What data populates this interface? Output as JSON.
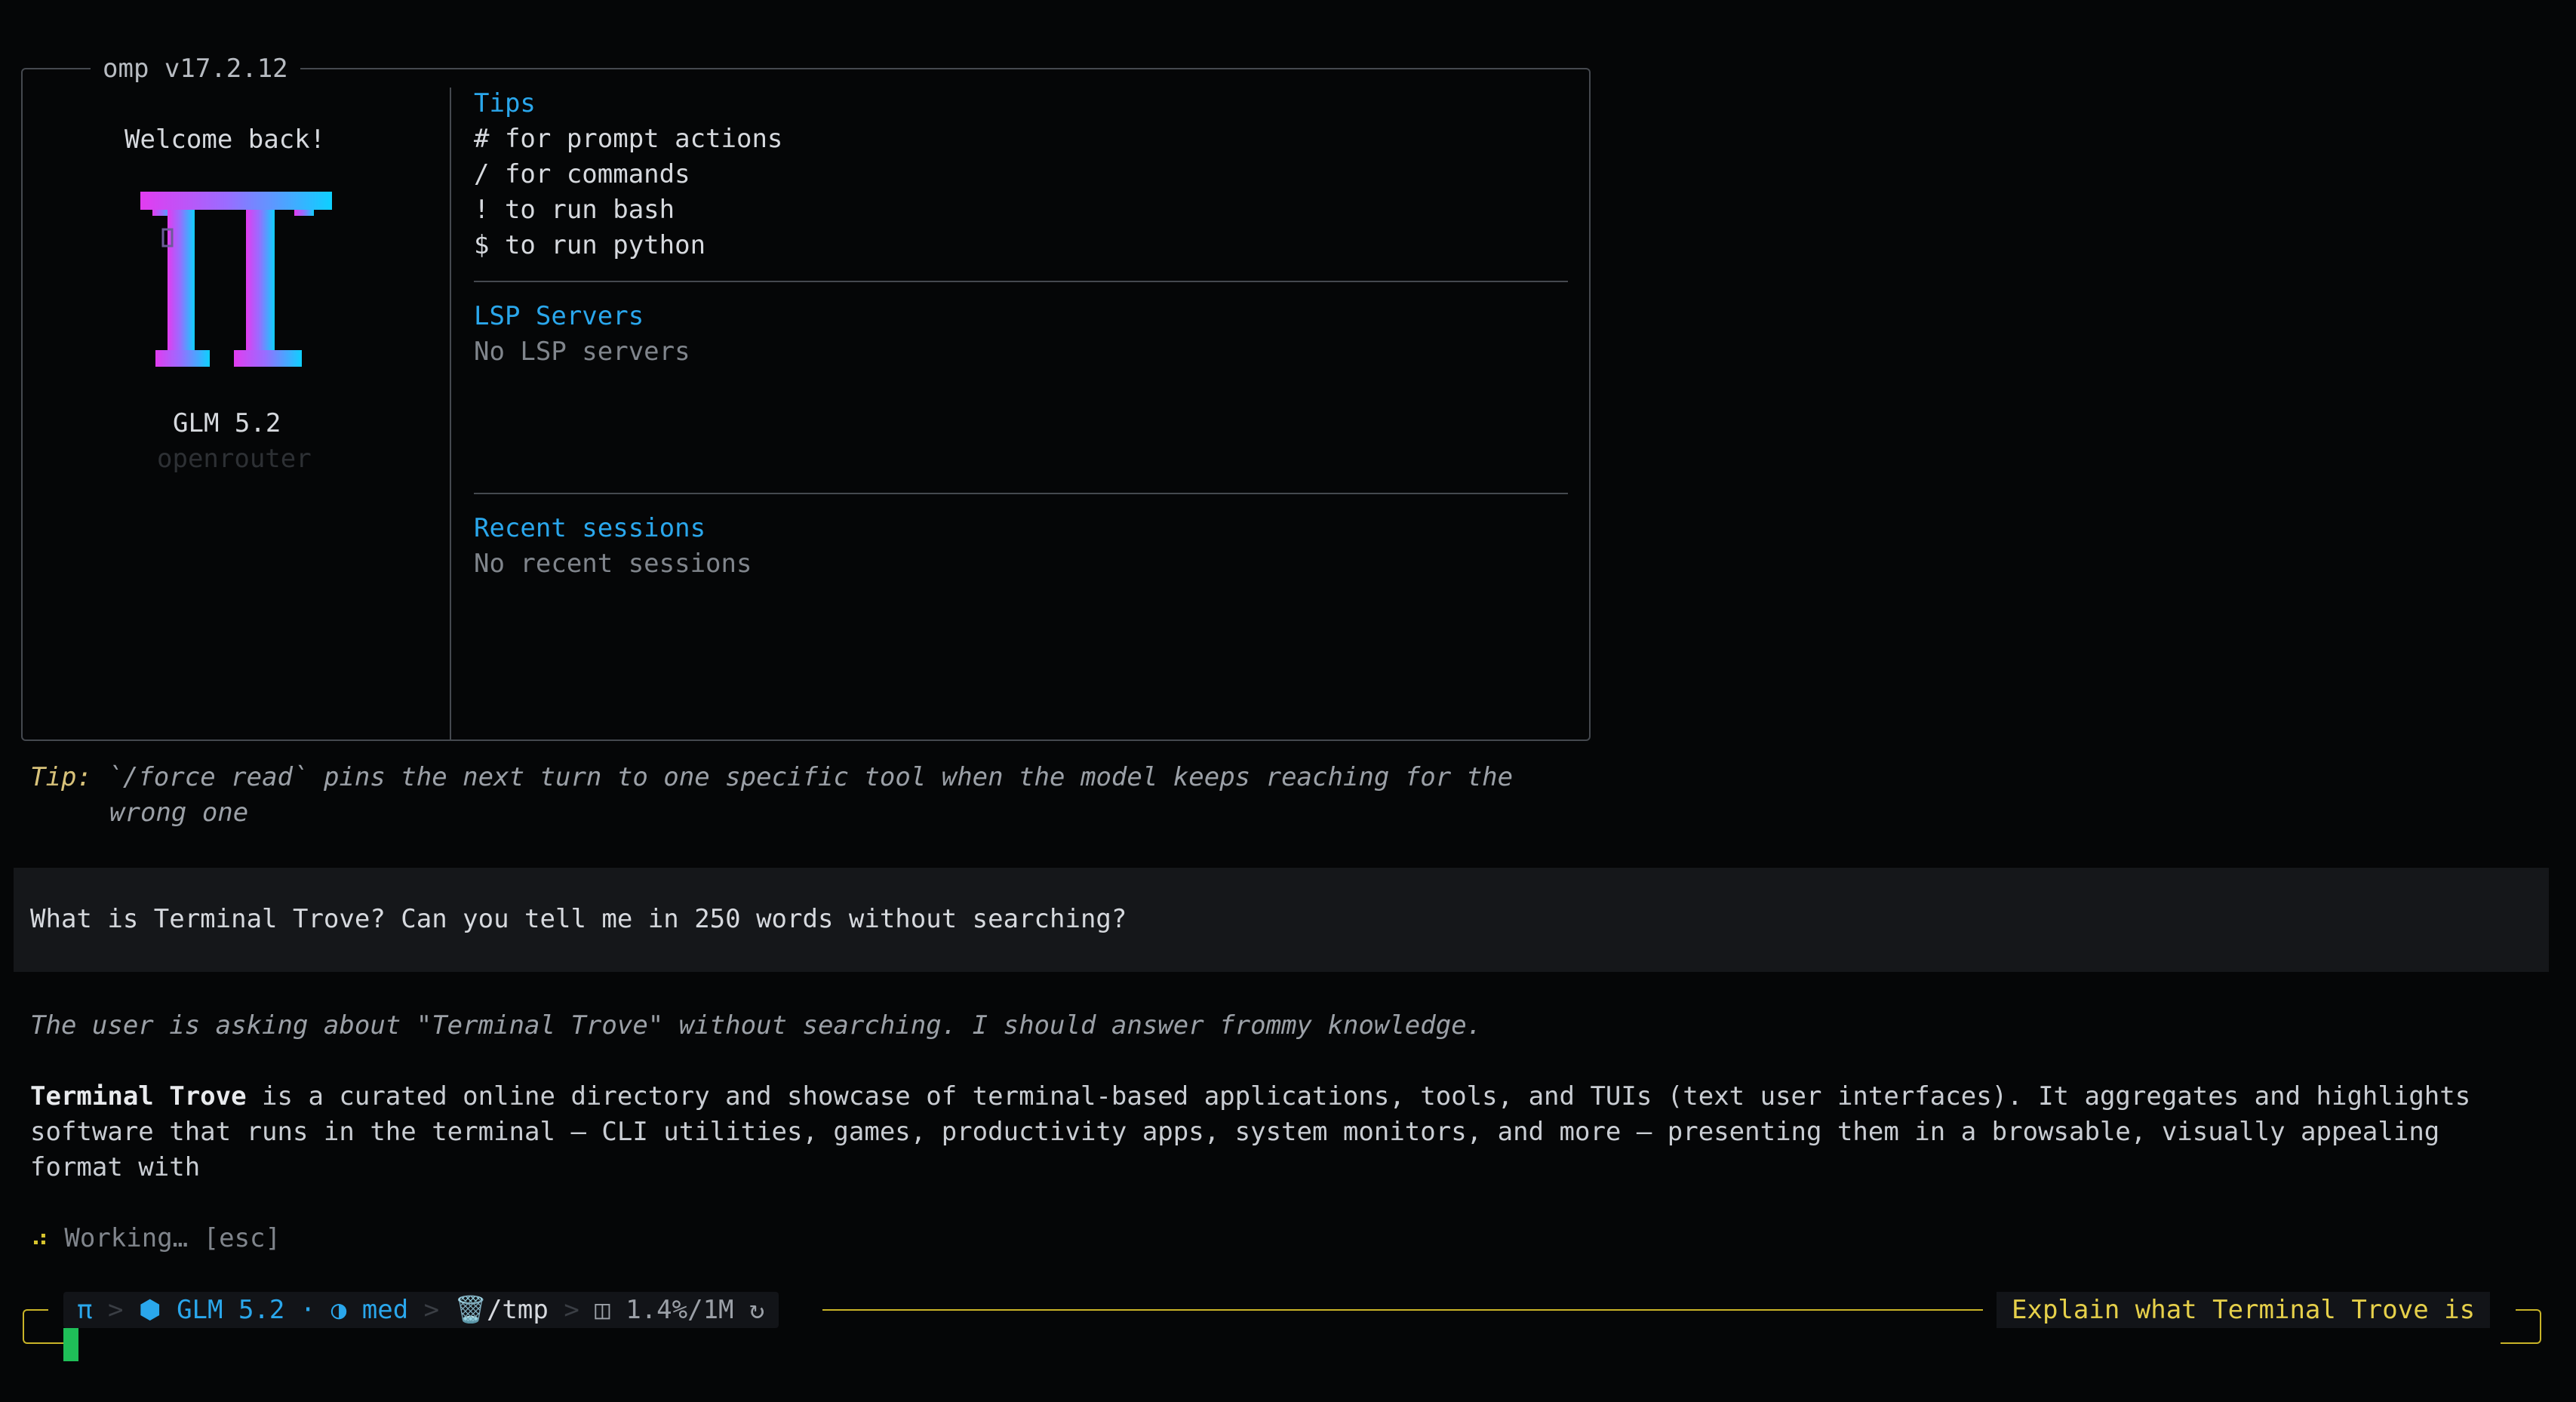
{
  "welcome_box": {
    "title": "omp v17.2.12",
    "greeting": "Welcome back!",
    "model_name": "GLM 5.2",
    "provider": "openrouter",
    "logo_icon": "pi-logo-icon"
  },
  "tips": {
    "heading": "Tips",
    "items": [
      "# for prompt actions",
      "/ for commands",
      "! to run bash",
      "$ to run python"
    ]
  },
  "lsp": {
    "heading": "LSP Servers",
    "status": "No LSP servers"
  },
  "recent": {
    "heading": "Recent sessions",
    "status": "No recent sessions"
  },
  "tip_line": {
    "label": "Tip:",
    "text_line1": "`/force read` pins the next turn to one specific tool when the model keeps reaching for the",
    "text_line2": "wrong one"
  },
  "user_message": "What is Terminal Trove? Can you tell me in 250 words without searching?",
  "assistant": {
    "thinking": "The user is asking about \"Terminal Trove\" without searching. I should answer frommy knowledge.",
    "answer_bold": "Terminal Trove",
    "answer_line1_rest": " is a curated online directory and showcase of terminal-based applications, tools, and TUIs (text user interfaces). It aggregates and highlights",
    "answer_line2": "software that runs in the terminal — CLI utilities, games, productivity apps, system monitors, and more — presenting them in a browsable, visually appealing",
    "answer_line3": "format with"
  },
  "working": {
    "spinner": "⠴",
    "text": "Working… ",
    "hint": "[esc]"
  },
  "status_bar": {
    "pi": "π",
    "sep": " > ",
    "model_icon": "⬢",
    "model": "GLM 5.2",
    "dot": " · ",
    "effort_icon": "◑",
    "effort": "med",
    "dir_icon": "🗑️",
    "dir": "/tmp",
    "ctx_icon": "◫",
    "ctx": "1.4%/1M",
    "cycle_icon": "↻"
  },
  "suggestion": "Explain what Terminal Trove is",
  "colors": {
    "accent": "#2aa7ec",
    "editor_border": "#c9b428",
    "cursor": "#1fbf58",
    "logo_gradient_start": "#e040f0",
    "logo_gradient_end": "#10c8ff"
  }
}
